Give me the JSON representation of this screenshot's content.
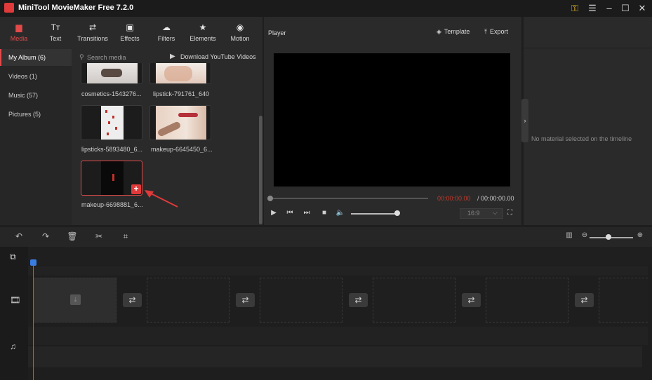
{
  "app": {
    "title": "MiniTool MovieMaker Free 7.2.0"
  },
  "toolbar": {
    "tabs": [
      {
        "label": "Media",
        "icon": "▆"
      },
      {
        "label": "Text",
        "icon": "Tт"
      },
      {
        "label": "Transitions",
        "icon": "⇄"
      },
      {
        "label": "Effects",
        "icon": "▣"
      },
      {
        "label": "Filters",
        "icon": "☁"
      },
      {
        "label": "Elements",
        "icon": "★"
      },
      {
        "label": "Motion",
        "icon": "◉"
      }
    ]
  },
  "sidebar": {
    "items": [
      {
        "label": "My Album (6)"
      },
      {
        "label": "Videos (1)"
      },
      {
        "label": "Music (57)"
      },
      {
        "label": "Pictures (5)"
      }
    ]
  },
  "media": {
    "search_placeholder": "Search media",
    "youtube_label": "Download YouTube Videos",
    "items": [
      {
        "label": "cosmetics-1543276..."
      },
      {
        "label": "lipstick-791761_640"
      },
      {
        "label": "lipsticks-5893480_6..."
      },
      {
        "label": "makeup-6645450_6..."
      },
      {
        "label": "makeup-6698881_6..."
      }
    ],
    "add_symbol": "+"
  },
  "player": {
    "title": "Player",
    "template_label": "Template",
    "export_label": "Export",
    "time_current": "00:00:00.00",
    "time_total": " / 00:00:00.00",
    "aspect_ratio": "16:9"
  },
  "properties": {
    "empty_text": "No material selected on the timeline"
  },
  "colors": {
    "accent": "#e24a4a",
    "playhead": "#3a7de0"
  }
}
